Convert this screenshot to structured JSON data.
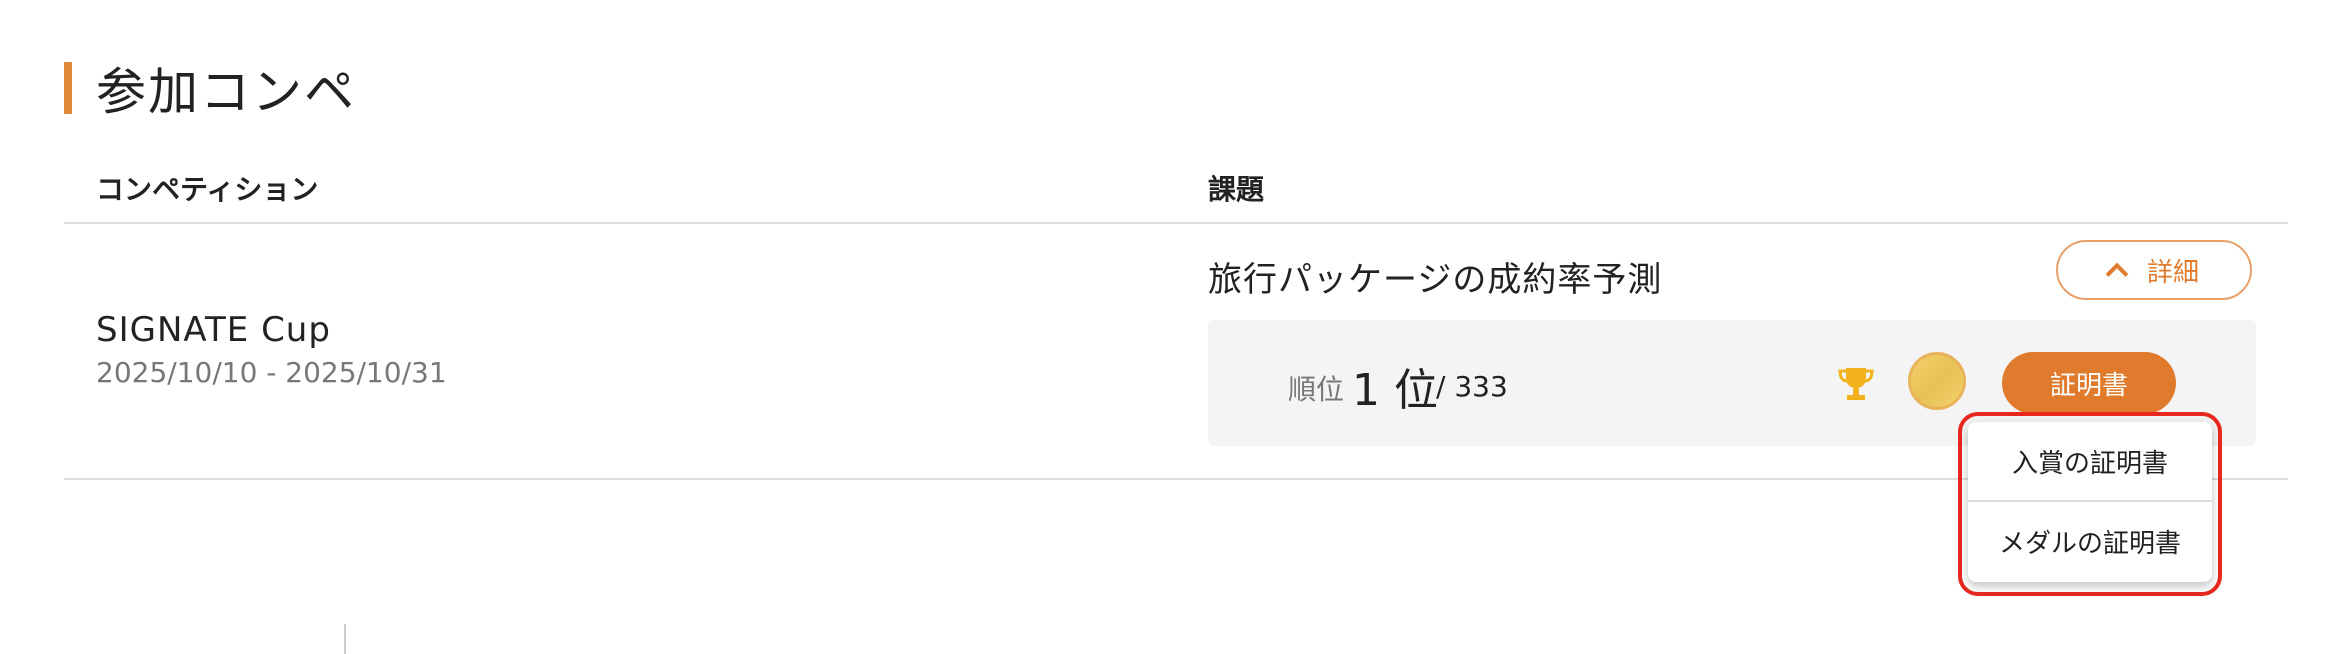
{
  "section": {
    "title": "参加コンペ",
    "accent_color": "#e08a3c"
  },
  "table": {
    "headers": {
      "competition": "コンペティション",
      "task": "課題"
    },
    "row": {
      "competition_name": "SIGNATE Cup",
      "competition_dates": "2025/10/10 - 2025/10/31",
      "task_title": "旅行パッケージの成約率予測",
      "detail_label": "詳細",
      "detail_icon": "chevron-up-icon",
      "result": {
        "rank_label": "順位",
        "rank_value": "1 位",
        "rank_total": "/ 333",
        "trophy_icon": "trophy-icon",
        "medal_icon": "gold-medal-icon",
        "certificate_label": "証明書"
      }
    }
  },
  "certificate_menu": {
    "items": [
      "入賞の証明書",
      "メダルの証明書"
    ],
    "highlight_color": "#e8281e"
  },
  "footer_partial": {
    "left": "",
    "right": ""
  },
  "colors": {
    "brand_orange": "#e07a2c",
    "panel_bg": "#f4f4f4",
    "gold": "#f3d16c"
  }
}
